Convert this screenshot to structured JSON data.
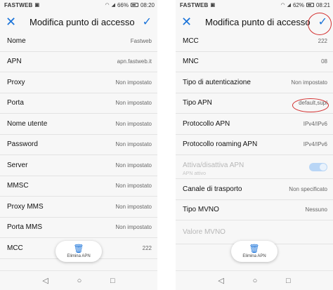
{
  "left": {
    "status": {
      "carrier": "FASTWEB",
      "battery": "66%",
      "time": "08:20"
    },
    "appbar": {
      "title": "Modifica punto di accesso",
      "close_glyph": "✕",
      "confirm_glyph": "✓"
    },
    "rows": [
      {
        "label": "Nome",
        "value": "Fastweb"
      },
      {
        "label": "APN",
        "value": "apn.fastweb.it"
      },
      {
        "label": "Proxy",
        "value": "Non impostato"
      },
      {
        "label": "Porta",
        "value": "Non impostato"
      },
      {
        "label": "Nome utente",
        "value": "Non impostato"
      },
      {
        "label": "Password",
        "value": "Non impostato"
      },
      {
        "label": "Server",
        "value": "Non impostato"
      },
      {
        "label": "MMSC",
        "value": "Non impostato"
      },
      {
        "label": "Proxy MMS",
        "value": "Non impostato"
      },
      {
        "label": "Porta MMS",
        "value": "Non impostato"
      },
      {
        "label": "MCC",
        "value": "222"
      }
    ],
    "fab": {
      "label": "Elimina APN",
      "icon": "trash-icon"
    }
  },
  "right": {
    "status": {
      "carrier": "FASTWEB",
      "battery": "62%",
      "time": "08:21"
    },
    "appbar": {
      "title": "Modifica punto di accesso",
      "close_glyph": "✕",
      "confirm_glyph": "✓"
    },
    "rows": [
      {
        "label": "MCC",
        "value": "222"
      },
      {
        "label": "MNC",
        "value": "08"
      },
      {
        "label": "Tipo di autenticazione",
        "value": "Non impostato"
      },
      {
        "label": "Tipo APN",
        "value": "default,supl"
      },
      {
        "label": "Protocollo APN",
        "value": "IPv4/IPv6"
      },
      {
        "label": "Protocollo roaming APN",
        "value": "IPv4/IPv6"
      },
      {
        "label": "Attiva/disattiva APN",
        "sublabel": "APN attivo",
        "toggle": true
      },
      {
        "label": "Canale di trasporto",
        "value": "Non specificato"
      },
      {
        "label": "Tipo MVNO",
        "value": "Nessuno"
      },
      {
        "label": "Valore MVNO",
        "value": ""
      }
    ],
    "fab": {
      "label": "Elimina APN",
      "icon": "trash-icon"
    }
  },
  "navbar": {
    "back": "◁",
    "home": "○",
    "recents": "□"
  },
  "annotation_color": "#d32f2f"
}
